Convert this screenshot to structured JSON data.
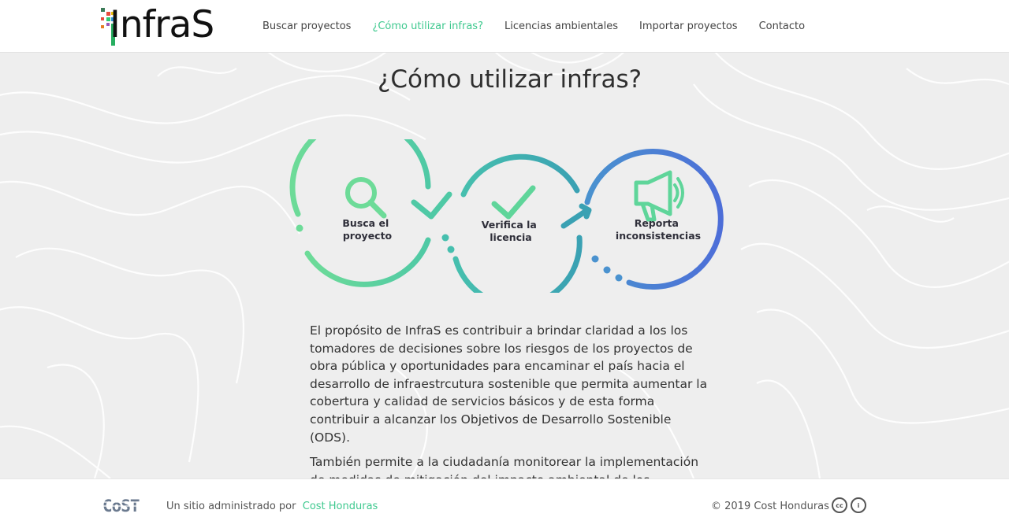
{
  "header": {
    "logo_text": "InfraS",
    "nav": [
      {
        "label": "Buscar proyectos",
        "active": false
      },
      {
        "label": "¿Cómo utilizar infras?",
        "active": true
      },
      {
        "label": "Licencias ambientales",
        "active": false
      },
      {
        "label": "Importar proyectos",
        "active": false
      },
      {
        "label": "Contacto",
        "active": false
      }
    ]
  },
  "main": {
    "title": "¿Cómo utilizar infras?",
    "steps": [
      {
        "line1": "Busca el",
        "line2": "proyecto",
        "icon": "search-icon"
      },
      {
        "line1": "Verifica la",
        "line2": "licencia",
        "icon": "check-icon"
      },
      {
        "line1": "Reporta",
        "line2": "inconsistencias",
        "icon": "megaphone-icon"
      }
    ],
    "paragraphs": [
      "El propósito de InfraS es contribuir a brindar claridad a los los tomadores de decisiones sobre los riesgos de los proyectos de obra pública y oportunidades para encaminar el país hacia el desarrollo de infraestrcutura sostenible que permita aumentar la cobertura y calidad de servicios básicos y de esta forma contribuir a alcanzar los Objetivos de Desarrollo Sostenible (ODS).",
      "También permite a la ciudadanía monitorear la implementación de medidas de mitigación del impacto ambiental de los proyectos."
    ]
  },
  "footer": {
    "logo_text": "CoST",
    "prefix": "Un sitio administrado por",
    "link": "Cost Honduras",
    "copyright": "© 2019 Cost Honduras",
    "license_icons": [
      "cc",
      "i"
    ]
  },
  "colors": {
    "accent": "#3fc98f",
    "teal": "#3aa8a8",
    "blue": "#4a6fd6",
    "background": "#eeeeee"
  }
}
